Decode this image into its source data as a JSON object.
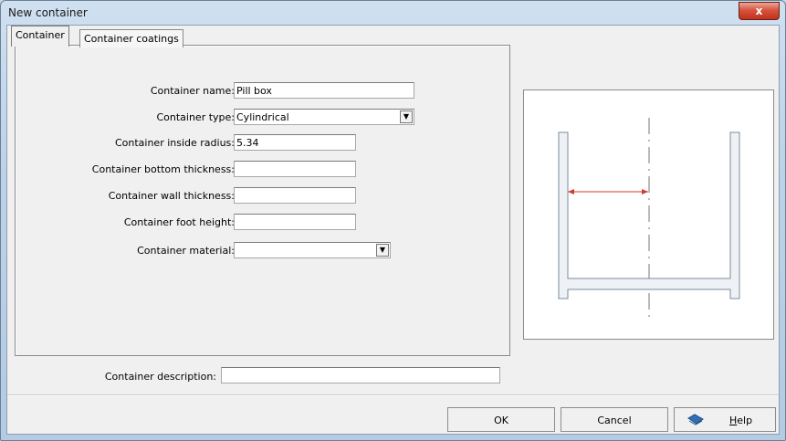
{
  "window": {
    "title": "New container",
    "close_label": "x"
  },
  "tabs": [
    {
      "label": "Container",
      "active": true
    },
    {
      "label": "Container coatings",
      "active": false
    }
  ],
  "form": {
    "name_label": "Container name:",
    "name_value": "Pill box",
    "type_label": "Container type:",
    "type_value": "Cylindrical",
    "radius_label": "Container inside radius:",
    "radius_value": "5.34",
    "bottom_label": "Container bottom thickness:",
    "bottom_value": "",
    "wall_label": "Container wall thickness:",
    "wall_value": "",
    "foot_label": "Container foot height:",
    "foot_value": "",
    "material_label": "Container material:",
    "material_value": "",
    "description_label": "Container description:",
    "description_value": ""
  },
  "buttons": {
    "ok": "OK",
    "cancel": "Cancel",
    "help_prefix": "",
    "help_underlined": "H",
    "help_rest": "elp"
  },
  "colors": {
    "accent_arrow": "#d43a2a",
    "title_bg": "#c9daea",
    "close_red": "#c7381f"
  },
  "icons": {
    "close": "close-icon",
    "help": "help-book-icon",
    "dropdown": "chevron-down-icon"
  }
}
